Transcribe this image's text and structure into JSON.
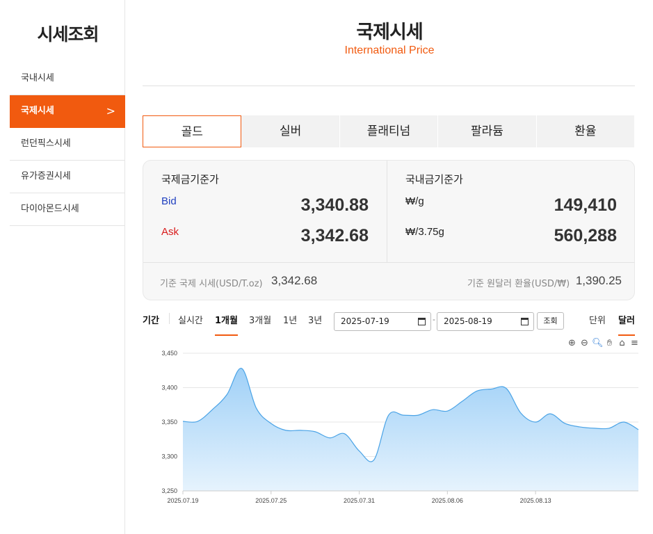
{
  "sidebar": {
    "title": "시세조회",
    "items": [
      {
        "label": "국내시세",
        "active": false
      },
      {
        "label": "국제시세",
        "active": true
      },
      {
        "label": "런던픽스시세",
        "active": false
      },
      {
        "label": "유가증권시세",
        "active": false
      },
      {
        "label": "다이아몬드시세",
        "active": false
      }
    ],
    "chevron": ">"
  },
  "header": {
    "title": "국제시세",
    "subtitle": "International Price"
  },
  "tabs": [
    {
      "label": "골드",
      "active": true
    },
    {
      "label": "실버",
      "active": false
    },
    {
      "label": "플래티넘",
      "active": false
    },
    {
      "label": "팔라듐",
      "active": false
    },
    {
      "label": "환율",
      "active": false
    }
  ],
  "prices": {
    "intl": {
      "heading": "국제금기준가",
      "bid_label": "Bid",
      "bid_value": "3,340.88",
      "ask_label": "Ask",
      "ask_value": "3,342.68"
    },
    "domestic": {
      "heading": "국내금기준가",
      "g_label": "₩/g",
      "g_value": "149,410",
      "don_label": "₩/3.75g",
      "don_value": "560,288"
    },
    "ref_intl_label": "기준 국제 시세(USD/T.oz)",
    "ref_intl_value": "3,342.68",
    "ref_fx_label": "기준 원달러 환율(USD/₩)",
    "ref_fx_value": "1,390.25"
  },
  "controls": {
    "period_label": "기간",
    "periods": [
      "실시간",
      "1개월",
      "3개월",
      "1년",
      "3년"
    ],
    "active_period": "1개월",
    "start_date": "2025-07-19",
    "end_date": "2025-08-19",
    "date_separator": "-",
    "search_label": "조회",
    "unit_label": "단위",
    "unit_value": "달러"
  },
  "chart_toolbar": [
    "zoom-in-icon",
    "zoom-out-icon",
    "zoom-select-icon",
    "pan-hand-icon",
    "home-icon",
    "menu-icon"
  ],
  "colors": {
    "accent": "#f15a0f",
    "line": "#4aa3e6",
    "fill_top": "#9fd0f7",
    "fill_bottom": "#e6f3fd",
    "bid": "#1f3fbf",
    "ask": "#d91c1c"
  },
  "chart_data": {
    "type": "area",
    "title": "",
    "xlabel": "",
    "ylabel": "",
    "ylim": [
      3250,
      3450
    ],
    "yticks": [
      "3,450",
      "3,400",
      "3,350",
      "3,300",
      "3,250"
    ],
    "yticks_values": [
      3450,
      3400,
      3350,
      3300,
      3250
    ],
    "xtick_labels": [
      "2025.07.19",
      "2025.07.25",
      "2025.07.31",
      "2025.08.06",
      "2025.08.13"
    ],
    "xtick_index": [
      0,
      6,
      12,
      18,
      24
    ],
    "grid": true,
    "x": [
      "2025.07.19",
      "2025.07.20",
      "2025.07.21",
      "2025.07.22",
      "2025.07.23",
      "2025.07.24",
      "2025.07.25",
      "2025.07.26",
      "2025.07.27",
      "2025.07.28",
      "2025.07.29",
      "2025.07.30",
      "2025.07.31",
      "2025.08.01",
      "2025.08.02",
      "2025.08.03",
      "2025.08.04",
      "2025.08.05",
      "2025.08.06",
      "2025.08.07",
      "2025.08.08",
      "2025.08.09",
      "2025.08.10",
      "2025.08.11",
      "2025.08.12",
      "2025.08.13",
      "2025.08.14",
      "2025.08.15",
      "2025.08.16",
      "2025.08.17",
      "2025.08.18",
      "2025.08.19"
    ],
    "series": [
      {
        "values": [
          3351,
          3351,
          3368,
          3390,
          3428,
          3370,
          3348,
          3338,
          3338,
          3336,
          3327,
          3333,
          3308,
          3295,
          3360,
          3360,
          3360,
          3368,
          3366,
          3380,
          3395,
          3398,
          3399,
          3363,
          3350,
          3362,
          3348,
          3343,
          3341,
          3341,
          3350,
          3339
        ]
      }
    ]
  }
}
